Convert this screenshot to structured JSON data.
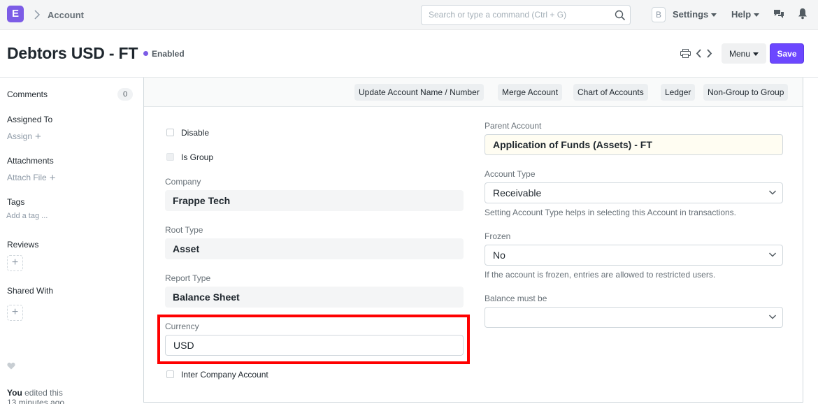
{
  "navbar": {
    "logo_letter": "E",
    "breadcrumb": "Account",
    "search_placeholder": "Search or type a command (Ctrl + G)",
    "avatar_letter": "B",
    "settings_label": "Settings",
    "help_label": "Help"
  },
  "page": {
    "title": "Debtors USD - FT",
    "status": "Enabled",
    "menu_label": "Menu",
    "save_label": "Save"
  },
  "sidebar": {
    "comments_label": "Comments",
    "comments_count": "0",
    "assigned_label": "Assigned To",
    "assign_link": "Assign",
    "attachments_label": "Attachments",
    "attach_link": "Attach File",
    "tags_label": "Tags",
    "add_tag": "Add a tag ...",
    "reviews_label": "Reviews",
    "shared_label": "Shared With",
    "activity_user": "You",
    "activity_text": "edited this",
    "activity_time": "13 minutes ago"
  },
  "toolbar": {
    "buttons": [
      "Update Account Name / Number",
      "Merge Account",
      "Chart of Accounts",
      "Ledger",
      "Non-Group to Group"
    ]
  },
  "form": {
    "disable_label": "Disable",
    "is_group_label": "Is Group",
    "company_label": "Company",
    "company_value": "Frappe Tech",
    "root_type_label": "Root Type",
    "root_type_value": "Asset",
    "report_type_label": "Report Type",
    "report_type_value": "Balance Sheet",
    "currency_label": "Currency",
    "currency_value": "USD",
    "inter_company_label": "Inter Company Account",
    "parent_account_label": "Parent Account",
    "parent_account_value": "Application of Funds (Assets) - FT",
    "account_type_label": "Account Type",
    "account_type_value": "Receivable",
    "account_type_help": "Setting Account Type helps in selecting this Account in transactions.",
    "frozen_label": "Frozen",
    "frozen_value": "No",
    "frozen_help": "If the account is frozen, entries are allowed to restricted users.",
    "balance_label": "Balance must be",
    "balance_value": ""
  },
  "colors": {
    "accent": "#7c5ce6",
    "primary_button": "#6c47ff",
    "highlight_box": "#ff0000"
  }
}
